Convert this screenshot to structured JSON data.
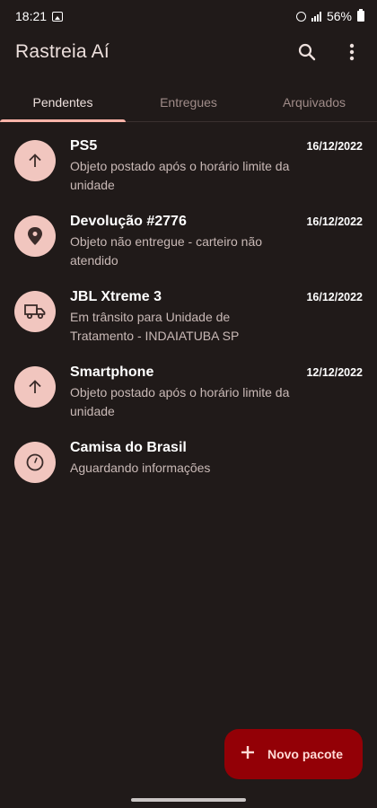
{
  "status_bar": {
    "time": "18:21",
    "battery": "56%"
  },
  "app_bar": {
    "title": "Rastreia Aí",
    "icons": [
      "search-icon",
      "more-vert-icon"
    ]
  },
  "tabs": [
    {
      "label": "Pendentes",
      "active": true
    },
    {
      "label": "Entregues",
      "active": false
    },
    {
      "label": "Arquivados",
      "active": false
    }
  ],
  "packages": [
    {
      "icon": "arrow-up-icon",
      "title": "PS5",
      "status": "Objeto postado após o horário limite da unidade",
      "date": "16/12/2022"
    },
    {
      "icon": "location-pin-icon",
      "title": "Devolução #2776",
      "status": "Objeto não entregue - carteiro não atendido",
      "date": "16/12/2022"
    },
    {
      "icon": "truck-icon",
      "title": "JBL Xtreme 3",
      "status": "Em trânsito para Unidade de Tratamento - INDAIATUBA SP",
      "date": "16/12/2022"
    },
    {
      "icon": "arrow-up-icon",
      "title": "Smartphone",
      "status": "Objeto postado após o horário limite da unidade",
      "date": "12/12/2022"
    },
    {
      "icon": "clock-icon",
      "title": "Camisa do Brasil",
      "status": "Aguardando informações",
      "date": ""
    }
  ],
  "fab": {
    "label": "Novo pacote",
    "icon": "plus-icon"
  },
  "colors": {
    "background": "#201a19",
    "icon_circle": "#f1c6bf",
    "tab_indicator": "#ffb4a9",
    "fab": "#930006"
  }
}
